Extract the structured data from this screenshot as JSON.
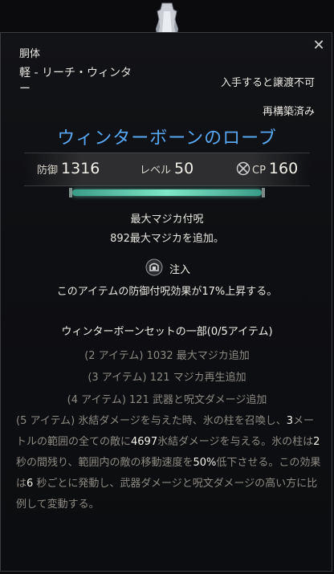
{
  "item": {
    "slot": "胴体",
    "weight": "軽 - リーチ・ウィンタ",
    "weight_cont": "ー",
    "bind": "入手すると譲渡不可",
    "reconstructed": "再構築済み",
    "name": "ウィンターボーンのローブ",
    "name_color": "#58a7f2"
  },
  "stats": {
    "armor_label": "防御",
    "armor_value": "1316",
    "level_label": "レベル",
    "level_value": "50",
    "cp_label": "CP",
    "cp_value": "160"
  },
  "condition_fraction": 1.0,
  "enchant": {
    "title": "最大マジカ付呪",
    "value": "892",
    "text": "最大マジカを追加。"
  },
  "infusion": {
    "label": "注入",
    "text_a": "このアイテムの防御付呪効果が",
    "value": "17%",
    "text_b": "上昇する。"
  },
  "set": {
    "header": "ウィンターボーンセットの一部(0/5アイテム)",
    "bonus2": "(2 アイテム) 1032 最大マジカ追加",
    "bonus3": "(3 アイテム) 121 マジカ再生追加",
    "bonus4": "(4 アイテム) 121 武器と呪文ダメージ追加",
    "bonus5": {
      "p1": "(5 アイテム) 氷結ダメージを与えた時、氷の柱を召喚し、",
      "n1": "3",
      "p2": "メートルの範囲の全ての敵に",
      "n2": "4697",
      "p3": "氷結ダメージを与える。氷の柱は",
      "n3": "2",
      "p4": " 秒の間残り、範囲内の敵の移動速度を",
      "n4": "50%",
      "p5": "低下させる。この効果は",
      "n5": "6",
      "p6": " 秒ごとに発動し、武器ダメージと呪文ダメージの高い方に比例して変動する。"
    }
  },
  "icons": {
    "close": "close-icon",
    "item": "robe-icon",
    "cp": "champion-point-icon",
    "infusion": "infusion-icon"
  }
}
